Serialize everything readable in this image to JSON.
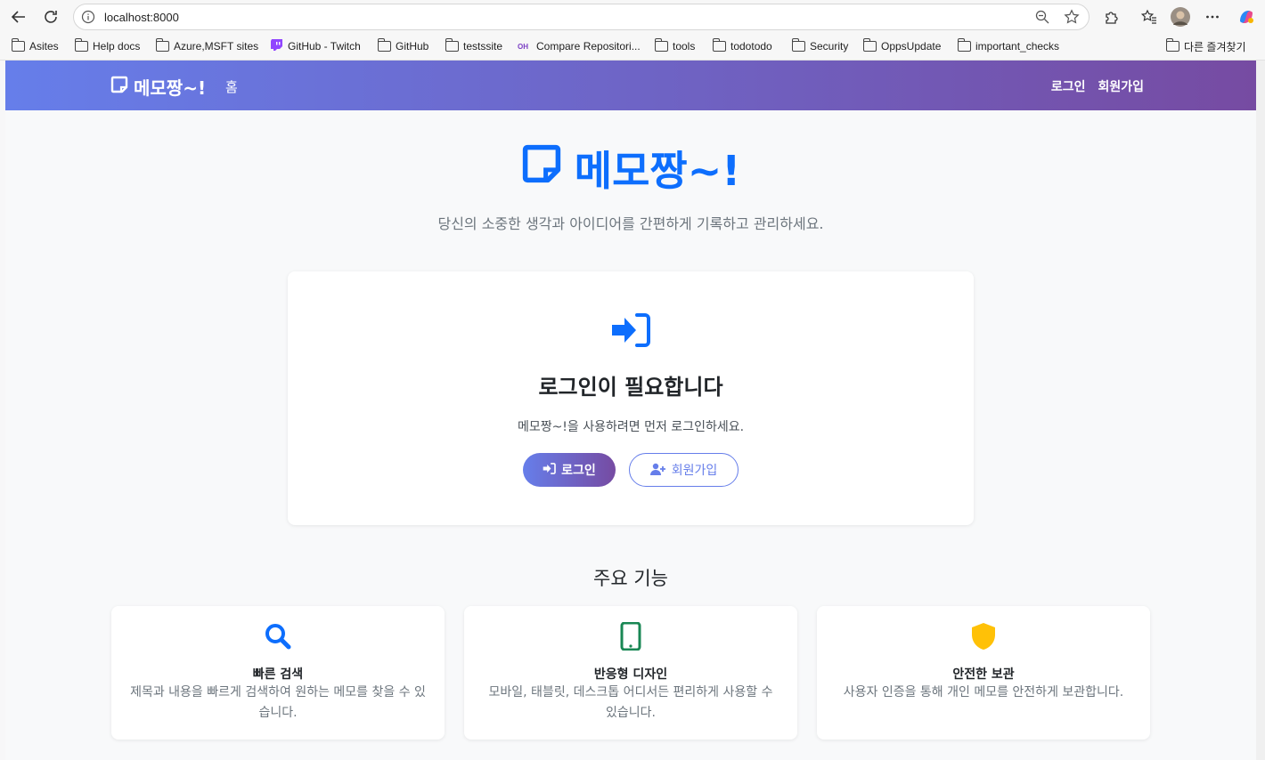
{
  "browser": {
    "url": "localhost:8000",
    "bookmarks": [
      {
        "label": "Asites",
        "icon": "folder-icon"
      },
      {
        "label": "Help docs",
        "icon": "folder-icon"
      },
      {
        "label": "Azure,MSFT sites",
        "icon": "folder-icon"
      },
      {
        "label": "GitHub - Twitch",
        "icon": "twitch-icon"
      },
      {
        "label": "GitHub",
        "icon": "folder-icon"
      },
      {
        "label": "testssite",
        "icon": "folder-icon"
      },
      {
        "label": "Compare Repositori...",
        "icon": "oh-icon"
      },
      {
        "label": "tools",
        "icon": "folder-icon"
      },
      {
        "label": "todotodo",
        "icon": "folder-icon"
      },
      {
        "label": "Security",
        "icon": "folder-icon"
      },
      {
        "label": "OppsUpdate",
        "icon": "folder-icon"
      },
      {
        "label": "important_checks",
        "icon": "folder-icon"
      }
    ],
    "other_favorites": "다른 즐겨찾기",
    "oh_badge": "OH"
  },
  "navbar": {
    "brand": "메모짱~!",
    "home": "홈",
    "login": "로그인",
    "signup": "회원가입",
    "gradient": [
      "#667eea",
      "#764ba2"
    ]
  },
  "hero": {
    "title": "메모짱~!",
    "subtitle": "당신의 소중한 생각과 아이디어를 간편하게 기록하고 관리하세요."
  },
  "login_card": {
    "title": "로그인이 필요합니다",
    "text": "메모짱~!을 사용하려면 먼저 로그인하세요.",
    "login_button": "로그인",
    "signup_button": "회원가입"
  },
  "features": {
    "title": "주요 기능",
    "items": [
      {
        "icon": "search-icon",
        "color": "#0d6efd",
        "title": "빠른 검색",
        "desc": "제목과 내용을 빠르게 검색하여 원하는 메모를 찾을 수 있습니다."
      },
      {
        "icon": "mobile-icon",
        "color": "#198754",
        "title": "반응형 디자인",
        "desc": "모바일, 태블릿, 데스크톱 어디서든 편리하게 사용할 수 있습니다."
      },
      {
        "icon": "shield-icon",
        "color": "#ffc107",
        "title": "안전한 보관",
        "desc": "사용자 인증을 통해 개인 메모를 안전하게 보관합니다."
      }
    ]
  },
  "colors": {
    "primary": "#0d6efd",
    "muted": "#6c757d"
  }
}
